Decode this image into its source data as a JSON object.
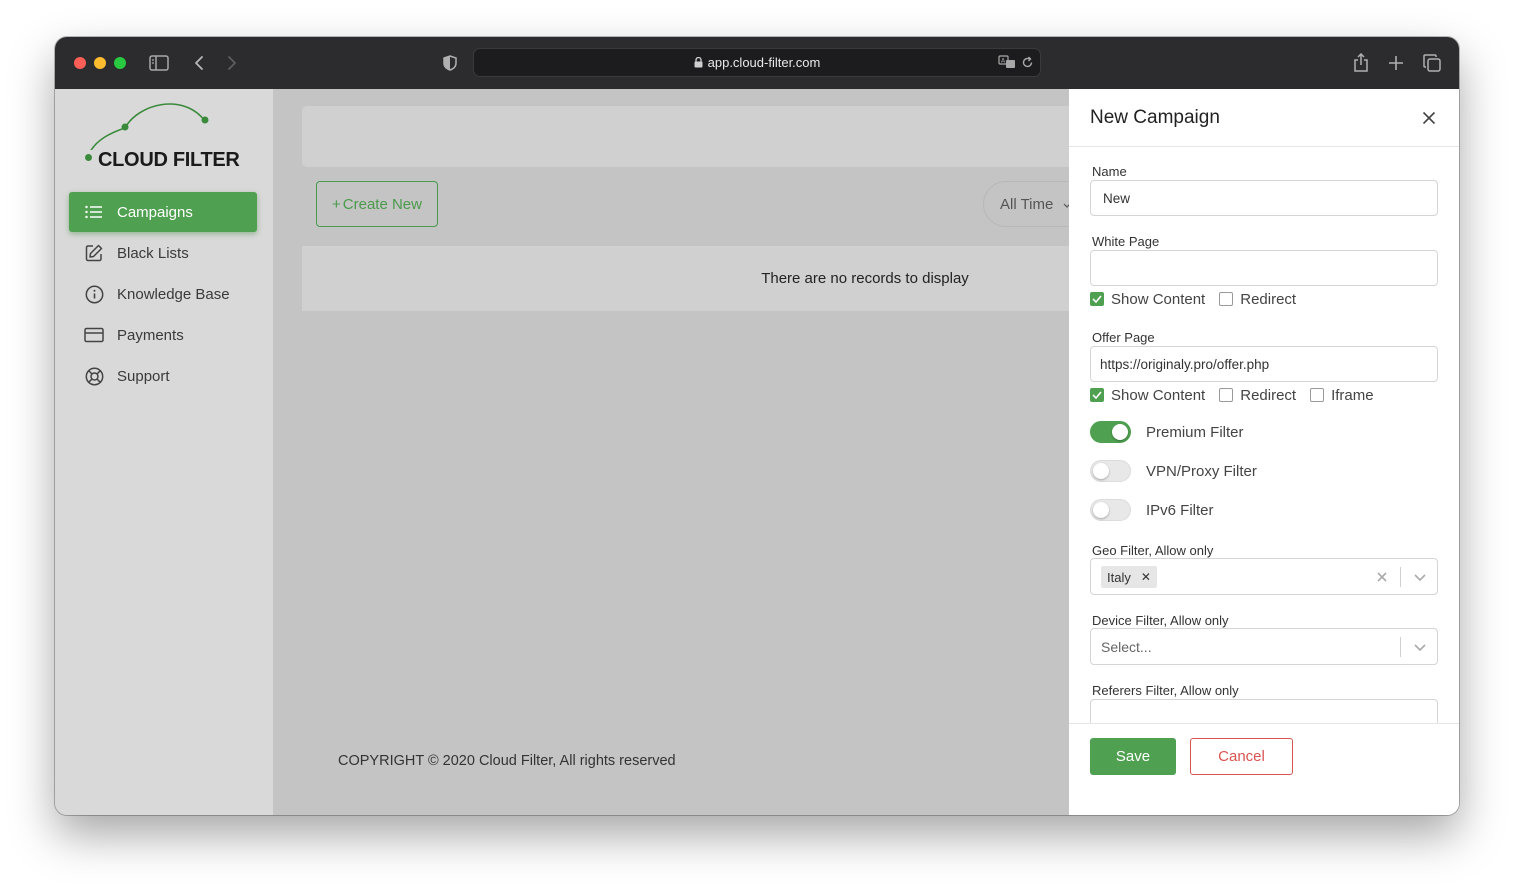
{
  "browser": {
    "url": "app.cloud-filter.com",
    "icons": [
      "sidebar-icon",
      "back-icon",
      "forward-icon",
      "shield-icon",
      "lock-icon",
      "translate-icon",
      "reload-icon",
      "share-icon",
      "new-tab-icon",
      "tabs-icon"
    ]
  },
  "sidebar": {
    "logo_text": "CLOUD FILTER",
    "items": [
      {
        "label": "Campaigns",
        "icon": "list-icon",
        "active": true
      },
      {
        "label": "Black Lists",
        "icon": "edit-icon",
        "active": false
      },
      {
        "label": "Knowledge Base",
        "icon": "info-icon",
        "active": false
      },
      {
        "label": "Payments",
        "icon": "card-icon",
        "active": false
      },
      {
        "label": "Support",
        "icon": "lifebuoy-icon",
        "active": false
      }
    ]
  },
  "main": {
    "create_new_label": "Create New",
    "time_filter_label": "All Time",
    "empty_message": "There are no records to display",
    "copyright": "COPYRIGHT © 2020 Cloud Filter, All rights reserved"
  },
  "drawer": {
    "title": "New Campaign",
    "name_label": "Name",
    "name_value": "New",
    "white_page_label": "White Page",
    "white_page_value": "",
    "white_show_content": "Show Content",
    "white_redirect": "Redirect",
    "offer_page_label": "Offer Page",
    "offer_page_value": "https://originaly.pro/offer.php",
    "offer_show_content": "Show Content",
    "offer_redirect": "Redirect",
    "offer_iframe": "Iframe",
    "premium_filter": "Premium Filter",
    "vpn_filter": "VPN/Proxy Filter",
    "ipv6_filter": "IPv6 Filter",
    "geo_label": "Geo Filter, Allow only",
    "geo_selected": "Italy",
    "device_label": "Device Filter, Allow only",
    "device_placeholder": "Select...",
    "referers_label": "Referers Filter, Allow only",
    "save_label": "Save",
    "cancel_label": "Cancel"
  },
  "colors": {
    "brand_green": "#4fa050",
    "danger_red": "#d9534f"
  }
}
